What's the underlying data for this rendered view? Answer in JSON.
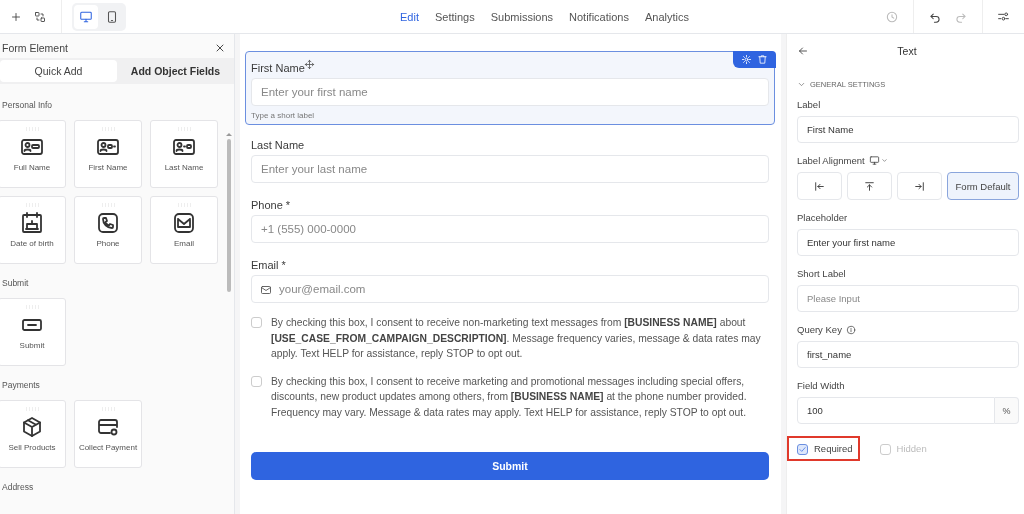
{
  "toolbar": {
    "devices": [
      {
        "kind": "desktop",
        "selected": true
      },
      {
        "kind": "mobile",
        "selected": false
      }
    ],
    "tabs": [
      {
        "label": "Edit",
        "selected": true
      },
      {
        "label": "Settings",
        "selected": false
      },
      {
        "label": "Submissions",
        "selected": false
      },
      {
        "label": "Notifications",
        "selected": false
      },
      {
        "label": "Analytics",
        "selected": false
      }
    ]
  },
  "elements_panel": {
    "title": "Form Element",
    "tabs": [
      {
        "label": "Quick Add",
        "selected": false
      },
      {
        "label": "Add Object Fields",
        "selected": true
      }
    ],
    "sections": [
      {
        "title": "Personal Info",
        "items": [
          {
            "label": "Full Name",
            "kind": "full-name"
          },
          {
            "label": "First Name",
            "kind": "first-name"
          },
          {
            "label": "Last Name",
            "kind": "last-name"
          },
          {
            "label": "Date of birth",
            "kind": "birthday"
          },
          {
            "label": "Phone",
            "kind": "phone"
          },
          {
            "label": "Email",
            "kind": "email"
          }
        ]
      },
      {
        "title": "Submit",
        "items": [
          {
            "label": "Submit",
            "kind": "submit"
          }
        ]
      },
      {
        "title": "Payments",
        "items": [
          {
            "label": "Sell Products",
            "kind": "product"
          },
          {
            "label": "Collect Payment",
            "kind": "payment"
          }
        ]
      },
      {
        "title": "Address"
      }
    ]
  },
  "form": {
    "fields": [
      {
        "label": "First Name",
        "placeholder": "Enter your first name",
        "hint": "Type a short label",
        "kind": "text",
        "selected": true
      },
      {
        "label": "Last Name",
        "placeholder": "Enter your last name",
        "kind": "text",
        "selected": false
      },
      {
        "label": "Phone *",
        "placeholder": "+1 (555) 000-0000",
        "kind": "text",
        "selected": false
      },
      {
        "label": "Email *",
        "placeholder": "your@email.com",
        "kind": "email",
        "selected": false
      }
    ],
    "consents": [
      {
        "text": "By checking this box, I consent to receive non-marketing text messages from **[BUSINESS NAME]** about **[USE_CASE_FROM_CAMPAIGN_DESCRIPTION]**. Message frequency varies, message & data rates may apply. Text HELP for assistance, reply STOP to opt out.",
        "checked": false
      },
      {
        "text": "By checking this box, I consent to receive marketing and promotional messages including special offers, discounts, new product updates among others, from **[BUSINESS NAME]** at the phone number provided. Frequency may vary. Message & data rates may apply. Text HELP for assistance, reply STOP to opt out.",
        "checked": false
      }
    ],
    "submit": "Submit"
  },
  "properties_panel": {
    "title": "Text",
    "section": {
      "title": "GENERAL SETTINGS",
      "expanded": true
    },
    "label": {
      "label": "Label",
      "value": "First Name"
    },
    "alignment": {
      "label": "Label Alignment",
      "options": [
        {
          "kind": "left",
          "selected": false
        },
        {
          "kind": "top",
          "selected": false
        },
        {
          "kind": "right",
          "selected": false
        },
        {
          "kind": "default",
          "label": "Form Default",
          "selected": true
        }
      ]
    },
    "placeholder": {
      "label": "Placeholder",
      "value": "Enter your first name"
    },
    "short_label": {
      "label": "Short Label",
      "placeholder": "Please Input"
    },
    "query_key": {
      "label": "Query Key",
      "value": "first_name"
    },
    "field_width": {
      "label": "Field Width",
      "value": "100",
      "suffix": "%"
    },
    "options": [
      {
        "label": "Required",
        "checked": true,
        "disabled": false,
        "highlighted": true
      },
      {
        "label": "Hidden",
        "checked": false,
        "disabled": true,
        "highlighted": false
      }
    ]
  }
}
